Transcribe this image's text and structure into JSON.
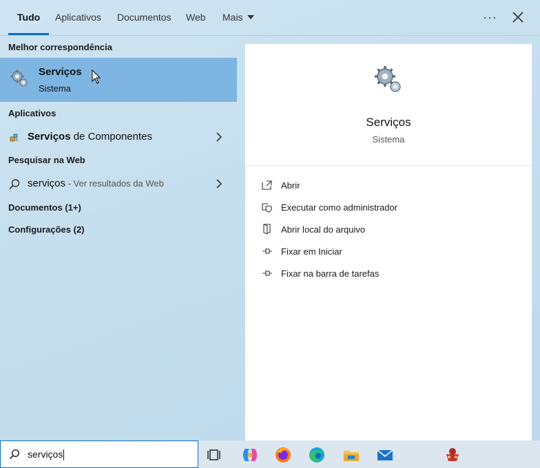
{
  "tabs": [
    {
      "label": "Tudo"
    },
    {
      "label": "Aplicativos"
    },
    {
      "label": "Documentos"
    },
    {
      "label": "Web"
    },
    {
      "label": "Mais"
    }
  ],
  "sections": {
    "best_match": "Melhor correspondência",
    "apps": "Aplicativos",
    "web": "Pesquisar na Web",
    "documents": "Documentos (1+)",
    "settings": "Configurações (2)"
  },
  "best_match_item": {
    "title": "Serviços",
    "subtitle": "Sistema",
    "icon": "services-gear-icon"
  },
  "apps_items": [
    {
      "bold": "Serviços",
      "rest": " de Componentes",
      "icon": "component-services-icon"
    }
  ],
  "web_items": [
    {
      "query": "serviços",
      "hint": " - Ver resultados da Web",
      "icon": "search-icon"
    }
  ],
  "preview": {
    "title": "Serviços",
    "subtitle": "Sistema",
    "actions": [
      {
        "label": "Abrir",
        "icon": "open-icon"
      },
      {
        "label": "Executar como administrador",
        "icon": "run-as-admin-icon"
      },
      {
        "label": "Abrir local do arquivo",
        "icon": "file-location-icon"
      },
      {
        "label": "Fixar em Iniciar",
        "icon": "pin-icon"
      },
      {
        "label": "Fixar na barra de tarefas",
        "icon": "pin-icon"
      }
    ]
  },
  "search": {
    "value": "serviços"
  },
  "taskbar_icons": [
    "task-view-icon",
    "copilot-icon",
    "firefox-icon",
    "edge-icon",
    "file-explorer-icon",
    "mail-icon",
    "app-icon"
  ],
  "colors": {
    "accent": "#0a6fc2",
    "selected": "#7eb5e2"
  }
}
